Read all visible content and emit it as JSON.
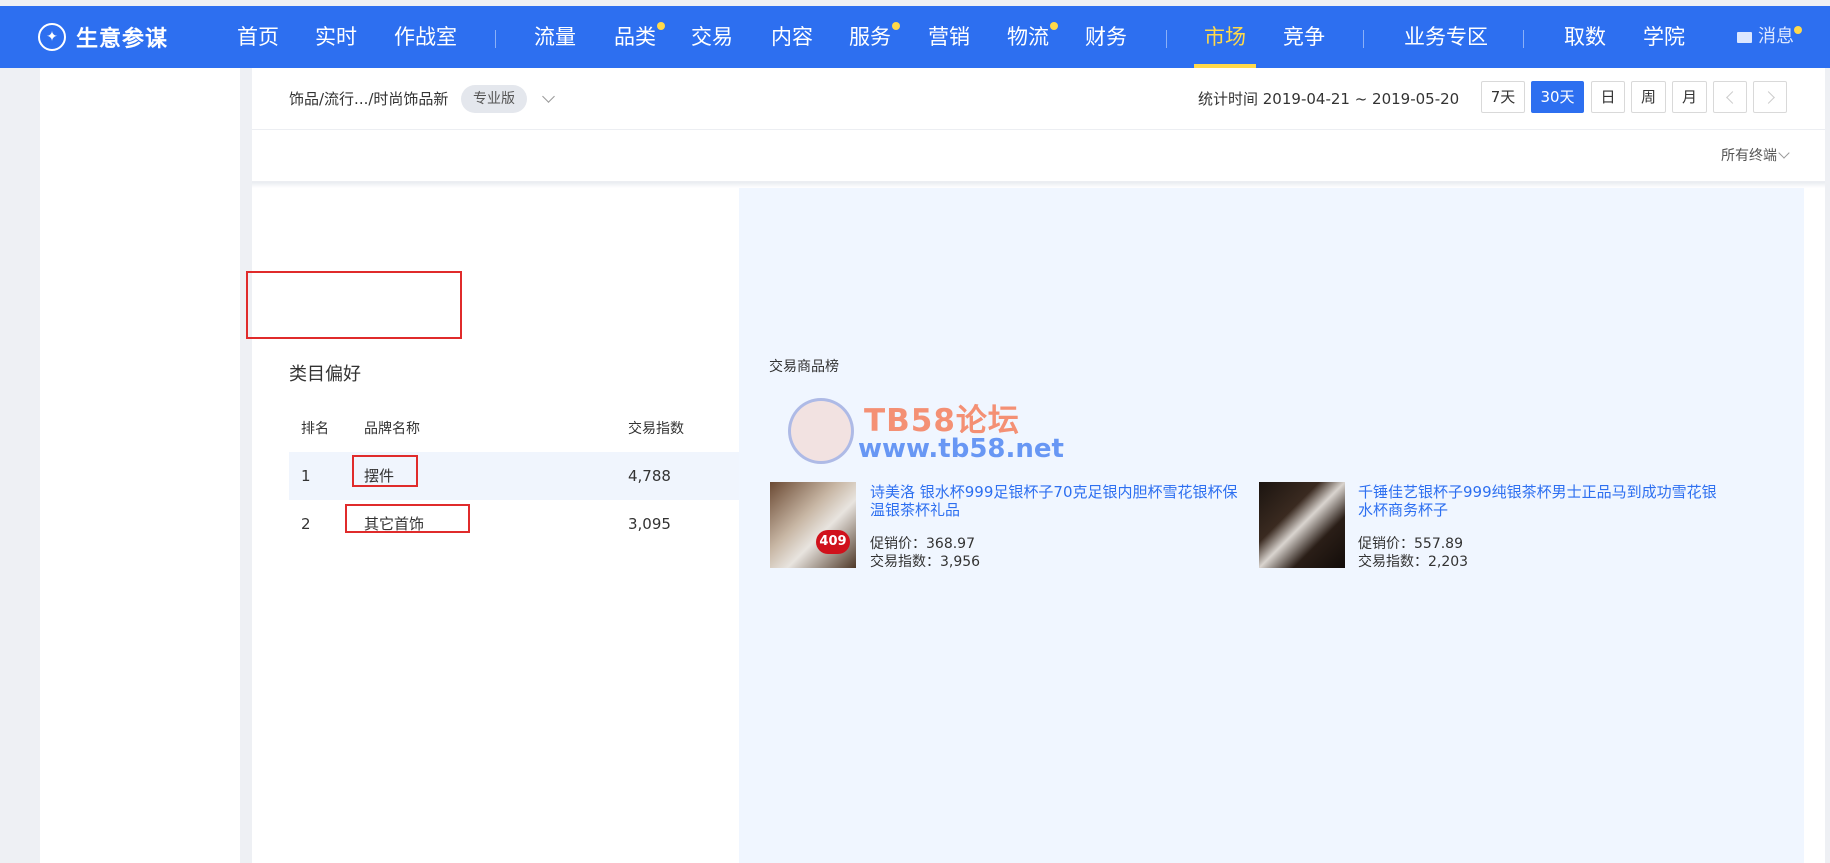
{
  "app": {
    "logo_text": "生意参谋"
  },
  "nav": {
    "items": [
      {
        "label": "首页"
      },
      {
        "label": "实时"
      },
      {
        "label": "作战室"
      },
      {
        "label": "流量"
      },
      {
        "label": "品类"
      },
      {
        "label": "交易"
      },
      {
        "label": "内容"
      },
      {
        "label": "服务"
      },
      {
        "label": "营销"
      },
      {
        "label": "物流"
      },
      {
        "label": "财务"
      },
      {
        "label": "市场"
      },
      {
        "label": "竞争"
      },
      {
        "label": "业务专区"
      },
      {
        "label": "取数"
      },
      {
        "label": "学院"
      }
    ],
    "active": "市场",
    "messages_label": "消息"
  },
  "toolbar": {
    "breadcrumb": "饰品/流行.../时尚饰品新",
    "edition": "专业版",
    "stat_time": "统计时间 2019-04-21 ~ 2019-05-20",
    "ranges": [
      "7天",
      "30天",
      "日",
      "周",
      "月"
    ],
    "active_range": "30天"
  },
  "subbar": {
    "terminal": "所有终端"
  },
  "section": {
    "title": "类目偏好"
  },
  "ranking": {
    "headers": {
      "rank": "排名",
      "name": "品牌名称",
      "index": "交易指数"
    },
    "rows": [
      {
        "rank": "1",
        "name": "摆件",
        "index": "4,788"
      },
      {
        "rank": "2",
        "name": "其它首饰",
        "index": "3,095"
      }
    ]
  },
  "products": {
    "title": "交易商品榜",
    "items": [
      {
        "name": "诗美洛 银水杯999足银杯子70克足银内胆杯雪花银杯保温银茶杯礼品",
        "price": "促销价：368.97",
        "index": "交易指数：3,956",
        "badge": "409"
      },
      {
        "name": "千锤佳艺银杯子999纯银茶杯男士正品马到成功雪花银水杯商务杯子",
        "price": "促销价：557.89",
        "index": "交易指数：2,203"
      }
    ]
  },
  "watermark": {
    "line1": "TB58论坛",
    "line2": "www.tb58.net"
  },
  "colors": {
    "nav_bg": "#2d6ff0",
    "accent": "#ffd94a",
    "panel_bg": "#f0f6ff",
    "annotation": "#e02b2b"
  }
}
